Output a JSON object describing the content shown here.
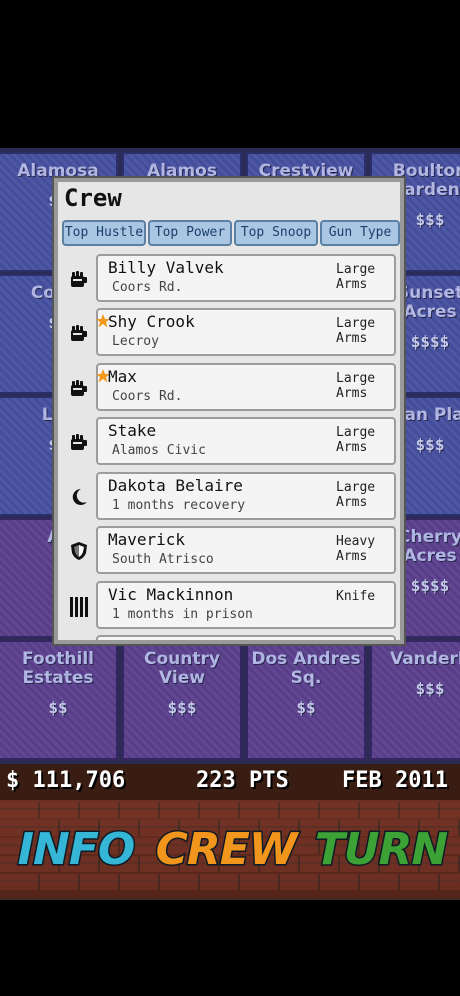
{
  "colors": {
    "tile_blue": "#4650a0",
    "tile_purple": "#5b3f8e",
    "tab_bg": "#a9c7e2",
    "star": "#f39a1c",
    "info_btn": "#35b6d6",
    "crew_btn": "#f2951c",
    "turn_btn": "#3ca236"
  },
  "map": {
    "tiles": [
      {
        "name": "Alamosa",
        "price": "$$",
        "color": "blue"
      },
      {
        "name": "Alamos",
        "price": "$$$",
        "color": "blue"
      },
      {
        "name": "Crestview",
        "price": "$$$",
        "color": "blue"
      },
      {
        "name": "Boulton Gardens",
        "price": "$$$",
        "color": "blue"
      },
      {
        "name": "Coors",
        "price": "$$",
        "color": "blue"
      },
      {
        "name": "",
        "price": "",
        "color": "blue"
      },
      {
        "name": "",
        "price": "",
        "color": "blue"
      },
      {
        "name": "Sunset Acres",
        "price": "$$$$",
        "color": "blue"
      },
      {
        "name": "Lec",
        "price": "$$",
        "color": "blue"
      },
      {
        "name": "",
        "price": "",
        "color": "blue"
      },
      {
        "name": "",
        "price": "",
        "color": "blue"
      },
      {
        "name": "Sloan Place",
        "price": "$$$",
        "color": "blue"
      },
      {
        "name": "Ar",
        "price": "$",
        "color": "purple"
      },
      {
        "name": "",
        "price": "",
        "color": "purple"
      },
      {
        "name": "",
        "price": "",
        "color": "purple"
      },
      {
        "name": "Cherry Acres",
        "price": "$$$$",
        "color": "purple"
      },
      {
        "name": "Foothill Estates",
        "price": "$$",
        "color": "purple"
      },
      {
        "name": "Country View",
        "price": "$$$",
        "color": "purple"
      },
      {
        "name": "Dos Andres Sq.",
        "price": "$$",
        "color": "purple"
      },
      {
        "name": "Vanderb",
        "price": "$$$",
        "color": "purple"
      }
    ]
  },
  "panel": {
    "title": "Crew",
    "sort_tabs": [
      "Top Hustle",
      "Top Power",
      "Top Snoop",
      "Gun Type"
    ],
    "rows": [
      {
        "icon": "fist-icon",
        "star": false,
        "name": "Billy Valvek",
        "location": "Coors Rd.",
        "weapon": "Large Arms"
      },
      {
        "icon": "fist-icon",
        "star": true,
        "name": "Shy Crook",
        "location": "Lecroy",
        "weapon": "Large Arms"
      },
      {
        "icon": "fist-icon",
        "star": true,
        "name": "Max",
        "location": "Coors Rd.",
        "weapon": "Large Arms"
      },
      {
        "icon": "fist-icon",
        "star": false,
        "name": "Stake",
        "location": "Alamos Civic",
        "weapon": "Large Arms"
      },
      {
        "icon": "moon-icon",
        "star": false,
        "name": "Dakota Belaire",
        "location": "1 months recovery",
        "weapon": "Large Arms"
      },
      {
        "icon": "shield-icon",
        "star": false,
        "name": "Maverick",
        "location": "South Atrisco",
        "weapon": "Heavy Arms"
      },
      {
        "icon": "prison-bars-icon",
        "star": false,
        "name": "Vic Mackinnon",
        "location": "1 months in prison",
        "weapon": "Knife"
      }
    ]
  },
  "hud": {
    "money": "$ 111,706",
    "points": "223 PTS",
    "date": "FEB 2011"
  },
  "buttons": {
    "info": "INFO",
    "crew": "CREW",
    "turn": "TURN"
  }
}
